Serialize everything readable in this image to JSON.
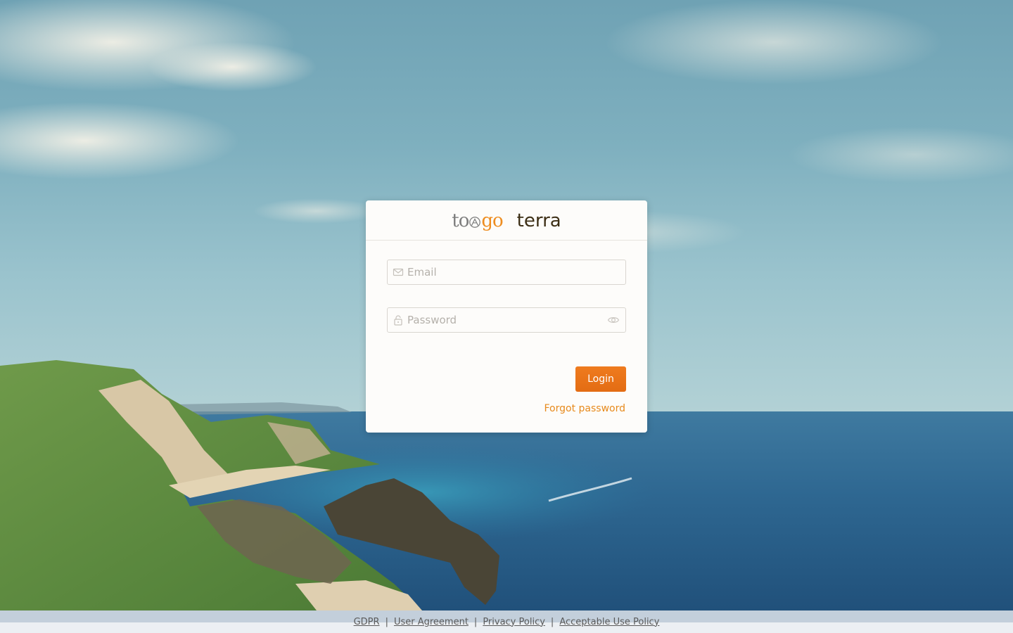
{
  "brand": {
    "logo_text_left": "to",
    "logo_text_right": "go",
    "product_name": "terra",
    "accent_color": "#ee8d20",
    "button_color": "#e8711a"
  },
  "login_form": {
    "email_placeholder": "Email",
    "email_value": "",
    "email_icon": "envelope-icon",
    "password_placeholder": "Password",
    "password_value": "",
    "password_icon": "lock-icon",
    "reveal_icon": "eye-icon",
    "login_label": "Login",
    "forgot_label": "Forgot password"
  },
  "footer": {
    "links": [
      {
        "label": "GDPR"
      },
      {
        "label": "User Agreement"
      },
      {
        "label": "Privacy Policy"
      },
      {
        "label": "Acceptable Use Policy"
      }
    ],
    "separator": "|"
  }
}
